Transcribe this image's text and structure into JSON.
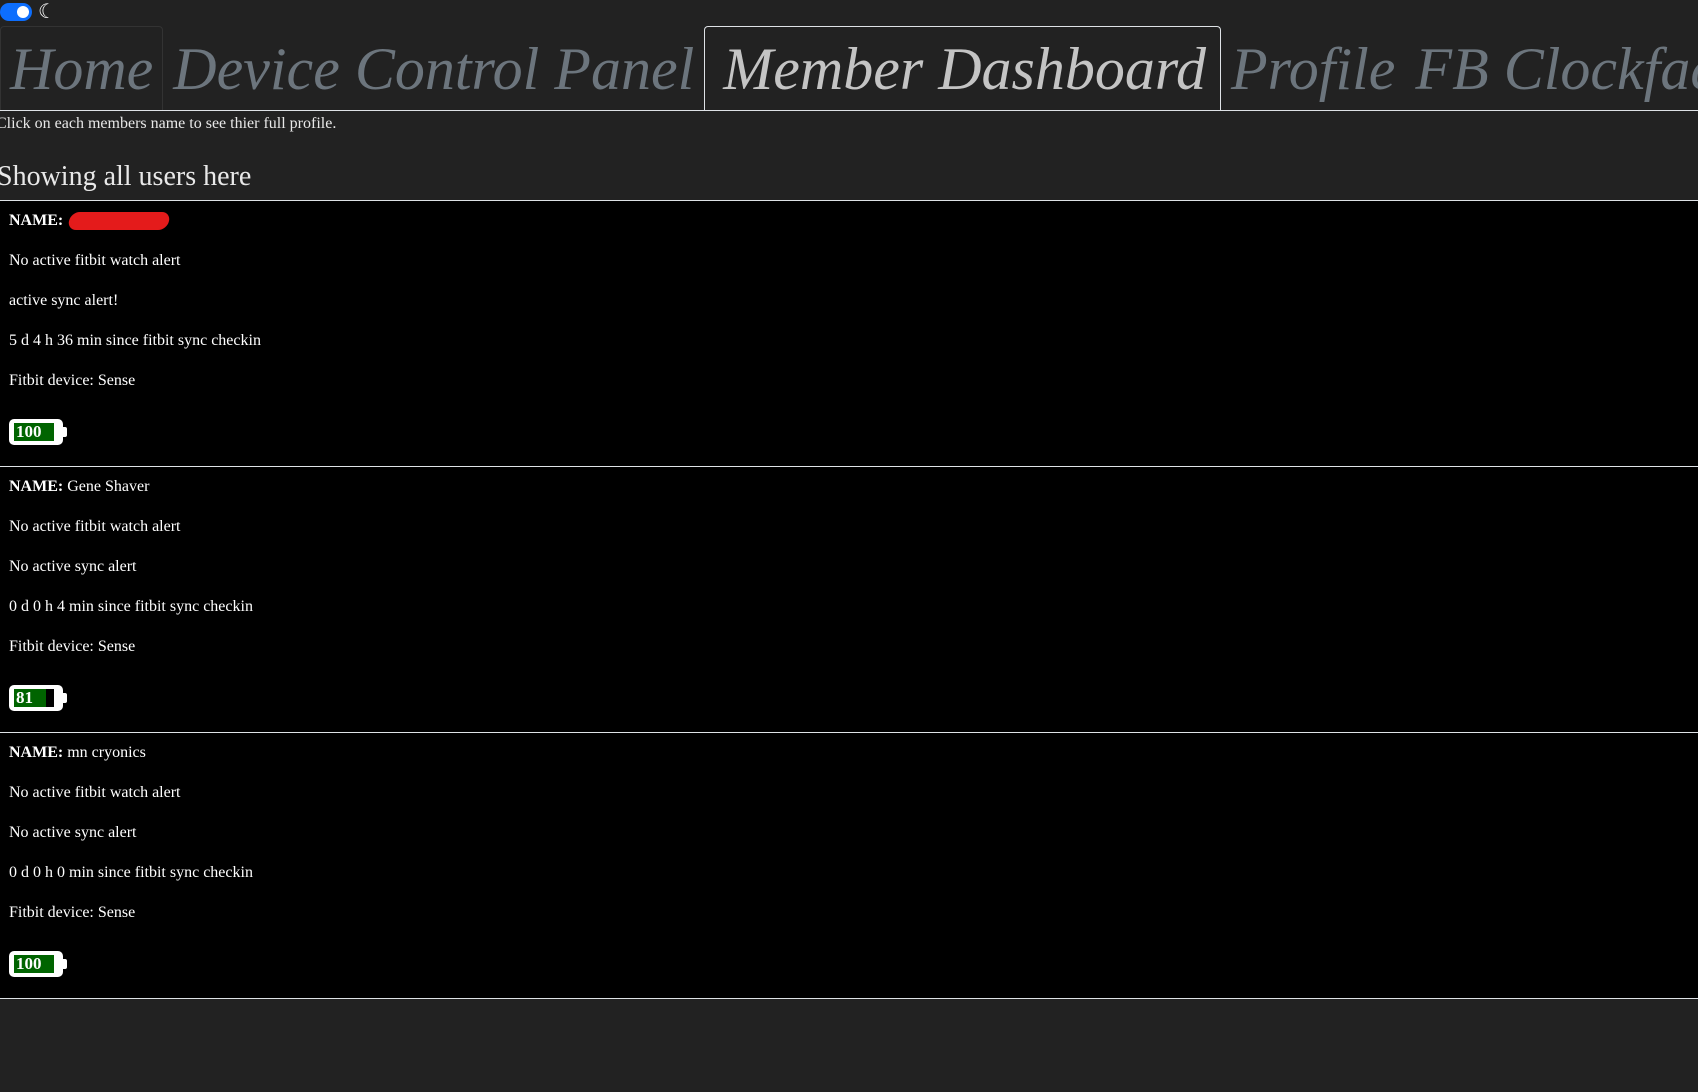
{
  "header": {
    "theme_toggle_on": true,
    "tabs": [
      {
        "label": "Home",
        "active": false
      },
      {
        "label": "Device Control Panel",
        "active": false
      },
      {
        "label": "Member Dashboard",
        "active": true
      },
      {
        "label": "Profile",
        "active": false
      },
      {
        "label": "FB Clockface",
        "active": false
      }
    ]
  },
  "main": {
    "intro_text": "Click on each members name to see thier full profile.",
    "heading": "Showing all users here",
    "name_label": "NAME:",
    "users": [
      {
        "name": "",
        "name_redacted": true,
        "watch_alert": "No active fitbit watch alert",
        "sync_alert": "active sync alert!",
        "sync_checkin": "5 d 4 h 36 min since fitbit sync checkin",
        "device": "Fitbit device: Sense",
        "battery": "100",
        "battery_level": 1.0
      },
      {
        "name": "Gene Shaver",
        "name_redacted": false,
        "watch_alert": "No active fitbit watch alert",
        "sync_alert": "No active sync alert",
        "sync_checkin": "0 d 0 h 4 min since fitbit sync checkin",
        "device": "Fitbit device: Sense",
        "battery": "81",
        "battery_level": 0.81
      },
      {
        "name": "mn cryonics",
        "name_redacted": false,
        "watch_alert": "No active fitbit watch alert",
        "sync_alert": "No active sync alert",
        "sync_checkin": "0 d 0 h 0 min since fitbit sync checkin",
        "device": "Fitbit device: Sense",
        "battery": "100",
        "battery_level": 1.0
      }
    ]
  },
  "colors": {
    "page_background": "#222222",
    "card_background": "#000000",
    "battery_fill": "#006400",
    "redaction": "#e41b1b",
    "toggle": "#0d6efd"
  }
}
